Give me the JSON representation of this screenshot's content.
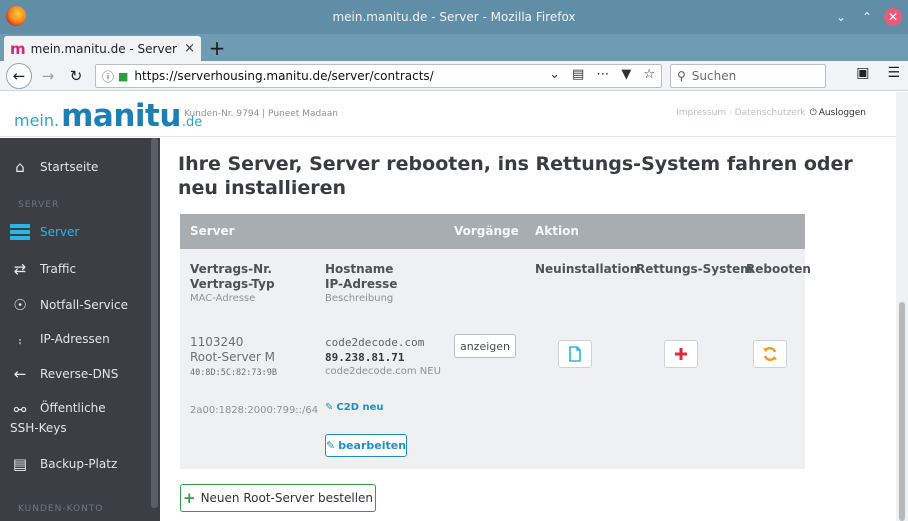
{
  "window": {
    "title": "mein.manitu.de - Server - Mozilla Firefox"
  },
  "tab": {
    "favicon": "m",
    "title": "mein.manitu.de - Server",
    "close": "×",
    "new_tab": "+"
  },
  "nav": {
    "url": "https://serverhousing.manitu.de/server/contracts/",
    "search_placeholder": "Suchen"
  },
  "header": {
    "logo_mein": "mein.",
    "logo_manitu": "manitu",
    "logo_de": ".de",
    "customer": "Kunden-Nr. 9794 | Puneet Madaan",
    "links": "Impressum · Datenschutzerk",
    "logout": "Ausloggen"
  },
  "sidebar": {
    "home": "Startseite",
    "section_server": "SERVER",
    "server": "Server",
    "traffic": "Traffic",
    "emergency": "Notfall-Service",
    "ip": "IP-Adressen",
    "rdns": "Reverse-DNS",
    "ssh_line1": "Öffentliche",
    "ssh_line2": "SSH-Keys",
    "backup": "Backup-Platz",
    "section_account": "KUNDEN-KONTO"
  },
  "main": {
    "title": "Ihre Server, Server rebooten, ins Rettungs-System fahren oder neu installieren",
    "table": {
      "headers": {
        "server": "Server",
        "processes": "Vorgänge",
        "action": "Aktion"
      },
      "sub": {
        "contract_no": "Vertrags-Nr.",
        "contract_type": "Vertrags-Typ",
        "mac": "MAC-Adresse",
        "hostname": "Hostname",
        "ip": "IP-Adresse",
        "description": "Beschreibung",
        "reinstall": "Neuinstallation",
        "rescue": "Rettungs-System",
        "reboot": "Rebooten"
      },
      "row": {
        "contract_no": "1103240",
        "contract_type": "Root-Server M",
        "mac": "40:8D:5C:82:73:9B",
        "ipv6": "2a00:1828:2000:799::/64",
        "hostname": "code2decode.com",
        "ip": "89.238.81.71",
        "description": "code2decode.com NEU",
        "c2d_link": "C2D neu",
        "edit": "bearbeiten",
        "show": "anzeigen"
      }
    },
    "order_button": "Neuen Root-Server bestellen"
  },
  "colors": {
    "titlebar": "#5f8ea6",
    "sidebar": "#3b3f44",
    "accent": "#2bb5e6",
    "brand": "#1d7fb3",
    "rescue_plus": "#e0283c",
    "reboot_icon": "#f29a1c",
    "order_border": "#2f9e47"
  }
}
